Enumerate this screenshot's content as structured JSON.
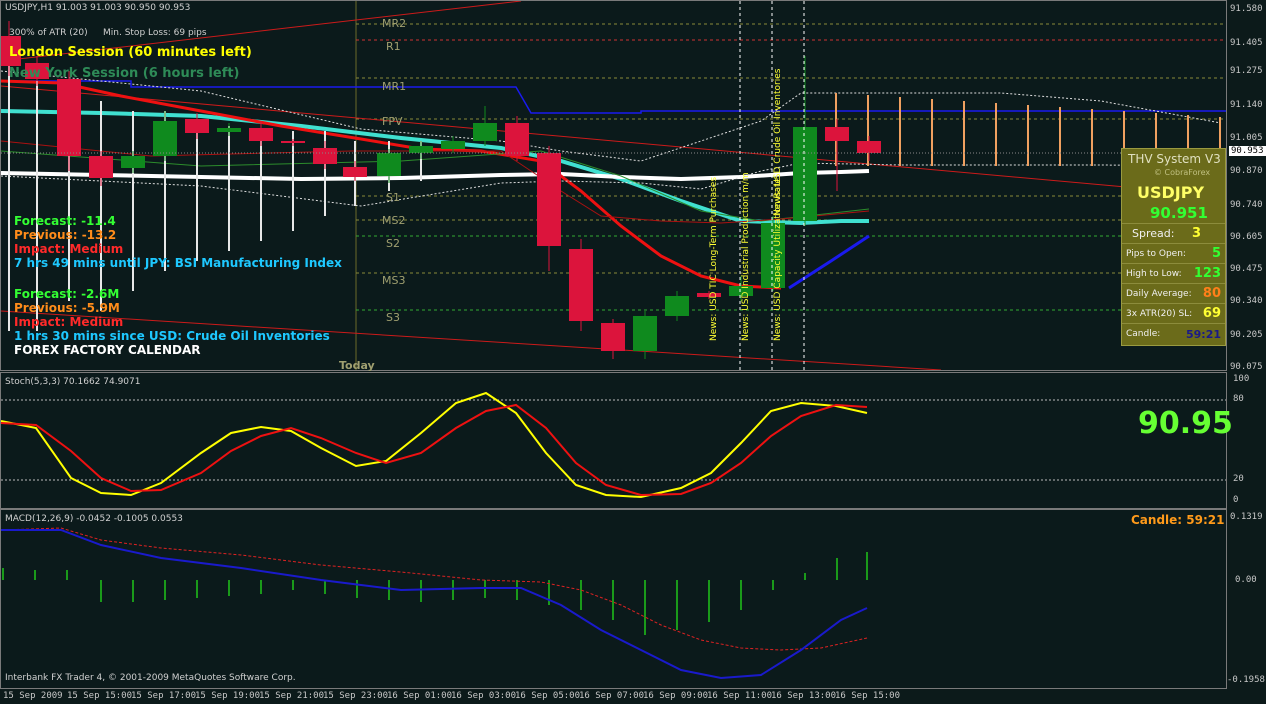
{
  "header": {
    "symbol_info": "USDJPY,H1  91.003 91.003 90.950 90.953",
    "atr_label": "300% of ATR (20)",
    "stop_loss": "Min. Stop Loss:  69 pips"
  },
  "sessions": {
    "london": "London Session (60 minutes left)",
    "newyork": "New York Session (6 hours left)"
  },
  "pivots": [
    "MR2",
    "R1",
    "MR1",
    "FPV",
    "S1",
    "MS2",
    "S2",
    "MS3",
    "S3"
  ],
  "today_label": "Today",
  "calendar": {
    "event1": {
      "forecast": "Forecast: -11.4",
      "previous": "Previous: -13.2",
      "impact": "Impact: Medium",
      "countdown": "7 hrs 49 mins until JPY: BSI Manufacturing Index"
    },
    "event2": {
      "forecast": "Forecast: -2.6M",
      "previous": "Previous: -5.9M",
      "impact": "Impact: Medium",
      "countdown": "1 hrs 30 mins since USD: Crude Oil Inventories"
    },
    "title": "FOREX FACTORY CALENDAR"
  },
  "news_labels": [
    "News: USD TIC Long-Term Purchases",
    "News: USD Industrial Production m/m",
    "News: USD Capacity Utilization Rate",
    "News: USD Crude Oil Inventories"
  ],
  "price_scale": [
    "91.580",
    "91.405",
    "91.275",
    "91.140",
    "91.005",
    "90.870",
    "90.740",
    "90.605",
    "90.475",
    "90.340",
    "90.205",
    "90.075"
  ],
  "current_price": "90.953",
  "thv": {
    "title": "THV System V3",
    "brand": "© CobraForex",
    "pair": "USDJPY",
    "price": "90.951",
    "spread_label": "Spread:",
    "spread": "3",
    "pips_label": "Pips to Open:",
    "pips": "5",
    "hl_label": "High to Low:",
    "hl": "123",
    "avg_label": "Daily Average:",
    "avg": "80",
    "atr_label": "3x ATR(20) SL:",
    "atr": "69",
    "candle_label": "Candle:",
    "candle": "59:21"
  },
  "stoch": {
    "label": "Stoch(5,3,3) 70.1662 74.9071",
    "big_price": "90.95",
    "scale": [
      "100",
      "80",
      "20",
      "0"
    ]
  },
  "macd": {
    "label": "MACD(12,26,9) -0.0452 -0.1005 0.0553",
    "candle_text": "Candle:  59:21",
    "scale": [
      "0.1319",
      "0.00",
      "-0.1958"
    ]
  },
  "copyright": "Interbank FX Trader 4, © 2001-2009 MetaQuotes Software Corp.",
  "time_axis": [
    "15 Sep 2009",
    "15 Sep 15:00",
    "15 Sep 17:00",
    "15 Sep 19:00",
    "15 Sep 21:00",
    "15 Sep 23:00",
    "16 Sep 01:00",
    "16 Sep 03:00",
    "16 Sep 05:00",
    "16 Sep 07:00",
    "16 Sep 09:00",
    "16 Sep 11:00",
    "16 Sep 13:00",
    "16 Sep 15:00"
  ],
  "colors": {
    "bull": "#0f8a1e",
    "bear": "#dc143c",
    "accent": "#ffff00",
    "bg": "#0b1a1b"
  }
}
